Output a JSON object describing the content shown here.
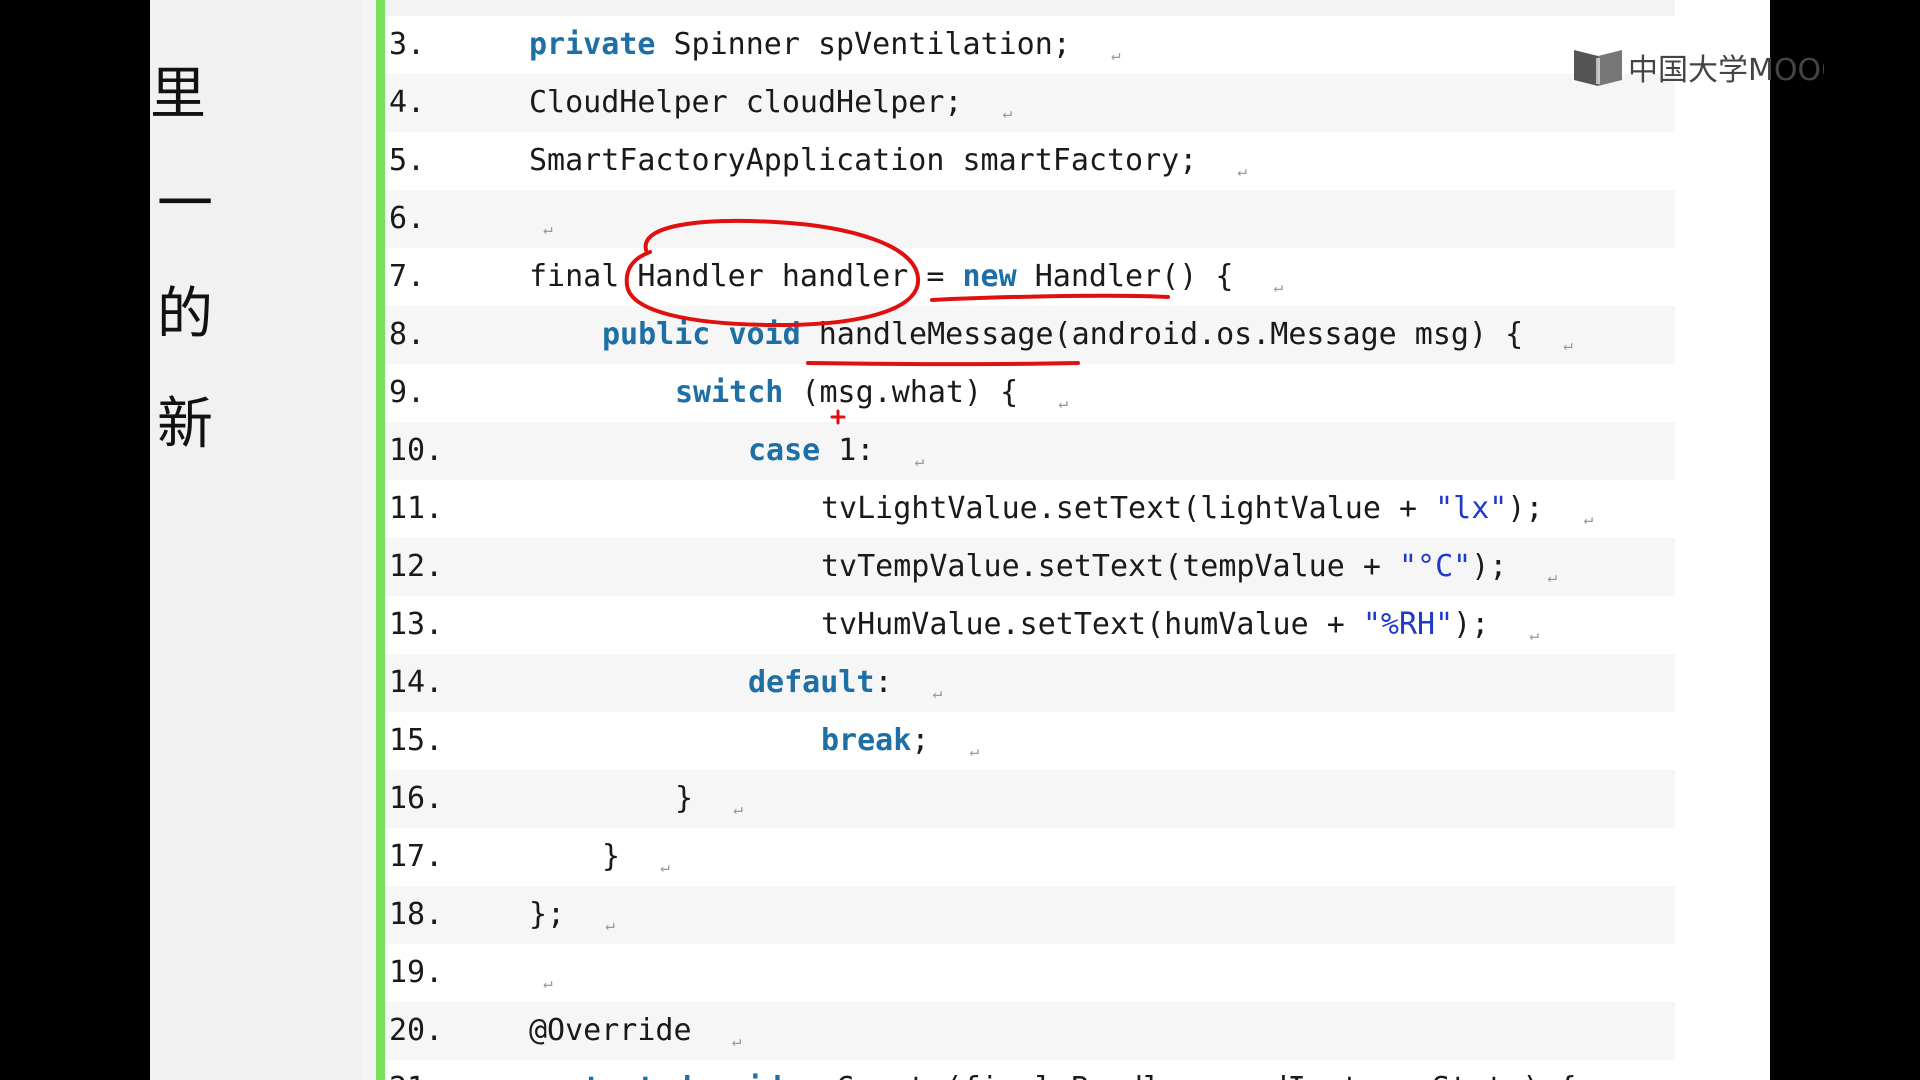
{
  "side_chars": [
    "里",
    "一",
    "的",
    "新"
  ],
  "logo": {
    "text": "中国大学MOOC",
    "icon": "mooc-book-icon"
  },
  "paragraph_mark": "↵",
  "colors": {
    "keyword": "#1d6fa5",
    "string": "#1f39c9",
    "annotation": "#e01010",
    "gutter_bar": "#7be05d"
  },
  "code_lines": [
    {
      "num": "3.",
      "indent": 0,
      "tokens": [
        {
          "t": "private",
          "c": "kw"
        },
        {
          "t": " Spinner spVentilation;"
        }
      ]
    },
    {
      "num": "4.",
      "indent": 0,
      "tokens": [
        {
          "t": "CloudHelper cloudHelper;"
        }
      ]
    },
    {
      "num": "5.",
      "indent": 0,
      "tokens": [
        {
          "t": "SmartFactoryApplication smartFactory;"
        }
      ]
    },
    {
      "num": "6.",
      "indent": -1,
      "tokens": []
    },
    {
      "num": "7.",
      "indent": 0,
      "tokens": [
        {
          "t": "final Handler handler = "
        },
        {
          "t": "new",
          "c": "kw"
        },
        {
          "t": " Handler() {"
        }
      ]
    },
    {
      "num": "8.",
      "indent": 1,
      "tokens": [
        {
          "t": "public",
          "c": "kw"
        },
        {
          "t": " "
        },
        {
          "t": "void",
          "c": "kw"
        },
        {
          "t": " handleMessage(android.os.Message msg) {"
        }
      ]
    },
    {
      "num": "9.",
      "indent": 2,
      "tokens": [
        {
          "t": "switch",
          "c": "kw"
        },
        {
          "t": " (msg.what) {"
        }
      ]
    },
    {
      "num": "10.",
      "indent": 3,
      "tokens": [
        {
          "t": "case",
          "c": "kw"
        },
        {
          "t": " 1:"
        }
      ]
    },
    {
      "num": "11.",
      "indent": 4,
      "tokens": [
        {
          "t": "tvLightValue.setText(lightValue + "
        },
        {
          "t": "\"lx\"",
          "c": "str"
        },
        {
          "t": ");"
        }
      ]
    },
    {
      "num": "12.",
      "indent": 4,
      "tokens": [
        {
          "t": "tvTempValue.setText(tempValue + "
        },
        {
          "t": "\"°C\"",
          "c": "str"
        },
        {
          "t": ");"
        }
      ]
    },
    {
      "num": "13.",
      "indent": 4,
      "tokens": [
        {
          "t": "tvHumValue.setText(humValue + "
        },
        {
          "t": "\"%RH\"",
          "c": "str"
        },
        {
          "t": ");"
        }
      ]
    },
    {
      "num": "14.",
      "indent": 3,
      "tokens": [
        {
          "t": "default",
          "c": "kw"
        },
        {
          "t": ":"
        }
      ]
    },
    {
      "num": "15.",
      "indent": 4,
      "tokens": [
        {
          "t": "break",
          "c": "kw"
        },
        {
          "t": ";"
        }
      ]
    },
    {
      "num": "16.",
      "indent": 2,
      "tokens": [
        {
          "t": "}"
        }
      ]
    },
    {
      "num": "17.",
      "indent": 1,
      "tokens": [
        {
          "t": "}"
        }
      ]
    },
    {
      "num": "18.",
      "indent": 0,
      "tokens": [
        {
          "t": "};"
        }
      ]
    },
    {
      "num": "19.",
      "indent": -1,
      "tokens": []
    },
    {
      "num": "20.",
      "indent": 0,
      "tokens": [
        {
          "t": "@Override"
        }
      ]
    },
    {
      "num": "21.",
      "indent": 0,
      "tokens": [
        {
          "t": "protected",
          "c": "kw"
        },
        {
          "t": " "
        },
        {
          "t": "void",
          "c": "kw"
        },
        {
          "t": " onCreate(final Bundle savedInstanceState) {"
        }
      ]
    }
  ]
}
